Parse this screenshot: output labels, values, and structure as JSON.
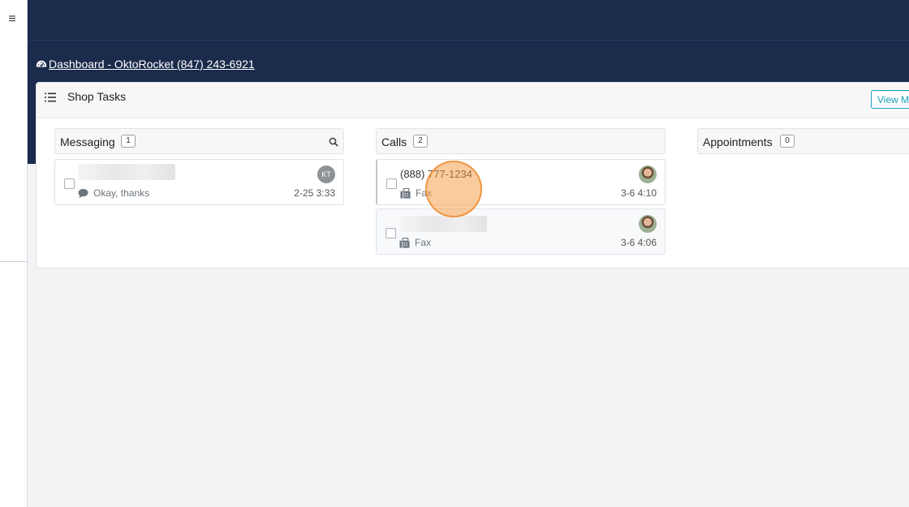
{
  "nav": {
    "menu_glyph": "≡"
  },
  "breadcrumb": {
    "text": "Dashboard - OktoRocket (847) 243-6921",
    "icon": "dashboard-gauge-icon"
  },
  "panel": {
    "title": "Shop Tasks",
    "view_button": "View My"
  },
  "columns": {
    "messaging": {
      "title": "Messaging",
      "count": "1",
      "cards": [
        {
          "name": "",
          "preview": "Okay, thanks",
          "time": "2-25 3:33",
          "avatar": "KT"
        }
      ]
    },
    "calls": {
      "title": "Calls",
      "count": "2",
      "cards": [
        {
          "number": "(888) 777-1234",
          "type": "Fax",
          "time": "3-6 4:10"
        },
        {
          "number": "",
          "type": "Fax",
          "time": "3-6 4:06"
        }
      ]
    },
    "appointments": {
      "title": "Appointments",
      "count": "0"
    }
  },
  "colors": {
    "header_navy": "#1b2b4c",
    "accent_teal": "#17a2b8",
    "click_highlight": "#f6a04a"
  }
}
